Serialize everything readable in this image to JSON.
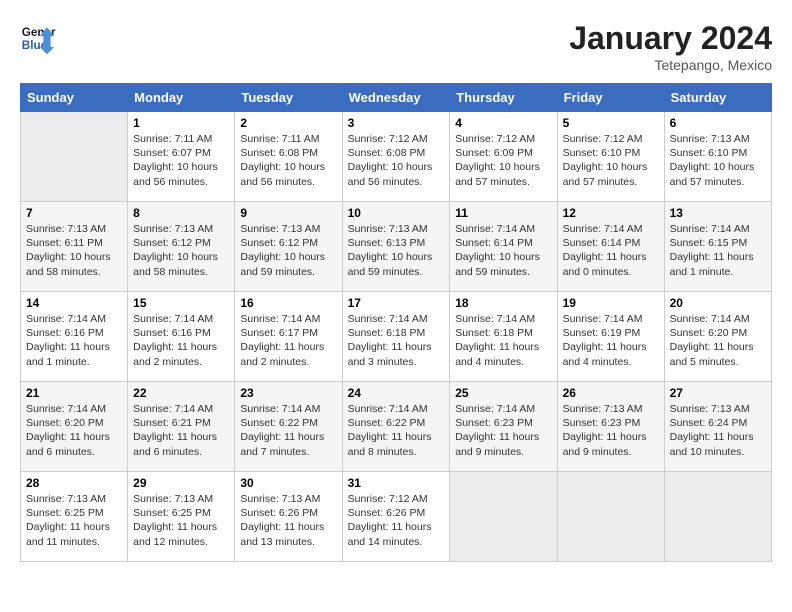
{
  "header": {
    "logo": {
      "line1": "General",
      "line2": "Blue"
    },
    "title": "January 2024",
    "subtitle": "Tetepango, Mexico"
  },
  "days_of_week": [
    "Sunday",
    "Monday",
    "Tuesday",
    "Wednesday",
    "Thursday",
    "Friday",
    "Saturday"
  ],
  "weeks": [
    [
      {
        "day": "",
        "info": ""
      },
      {
        "day": "1",
        "info": "Sunrise: 7:11 AM\nSunset: 6:07 PM\nDaylight: 10 hours\nand 56 minutes."
      },
      {
        "day": "2",
        "info": "Sunrise: 7:11 AM\nSunset: 6:08 PM\nDaylight: 10 hours\nand 56 minutes."
      },
      {
        "day": "3",
        "info": "Sunrise: 7:12 AM\nSunset: 6:08 PM\nDaylight: 10 hours\nand 56 minutes."
      },
      {
        "day": "4",
        "info": "Sunrise: 7:12 AM\nSunset: 6:09 PM\nDaylight: 10 hours\nand 57 minutes."
      },
      {
        "day": "5",
        "info": "Sunrise: 7:12 AM\nSunset: 6:10 PM\nDaylight: 10 hours\nand 57 minutes."
      },
      {
        "day": "6",
        "info": "Sunrise: 7:13 AM\nSunset: 6:10 PM\nDaylight: 10 hours\nand 57 minutes."
      }
    ],
    [
      {
        "day": "7",
        "info": "Sunrise: 7:13 AM\nSunset: 6:11 PM\nDaylight: 10 hours\nand 58 minutes."
      },
      {
        "day": "8",
        "info": "Sunrise: 7:13 AM\nSunset: 6:12 PM\nDaylight: 10 hours\nand 58 minutes."
      },
      {
        "day": "9",
        "info": "Sunrise: 7:13 AM\nSunset: 6:12 PM\nDaylight: 10 hours\nand 59 minutes."
      },
      {
        "day": "10",
        "info": "Sunrise: 7:13 AM\nSunset: 6:13 PM\nDaylight: 10 hours\nand 59 minutes."
      },
      {
        "day": "11",
        "info": "Sunrise: 7:14 AM\nSunset: 6:14 PM\nDaylight: 10 hours\nand 59 minutes."
      },
      {
        "day": "12",
        "info": "Sunrise: 7:14 AM\nSunset: 6:14 PM\nDaylight: 11 hours\nand 0 minutes."
      },
      {
        "day": "13",
        "info": "Sunrise: 7:14 AM\nSunset: 6:15 PM\nDaylight: 11 hours\nand 1 minute."
      }
    ],
    [
      {
        "day": "14",
        "info": "Sunrise: 7:14 AM\nSunset: 6:16 PM\nDaylight: 11 hours\nand 1 minute."
      },
      {
        "day": "15",
        "info": "Sunrise: 7:14 AM\nSunset: 6:16 PM\nDaylight: 11 hours\nand 2 minutes."
      },
      {
        "day": "16",
        "info": "Sunrise: 7:14 AM\nSunset: 6:17 PM\nDaylight: 11 hours\nand 2 minutes."
      },
      {
        "day": "17",
        "info": "Sunrise: 7:14 AM\nSunset: 6:18 PM\nDaylight: 11 hours\nand 3 minutes."
      },
      {
        "day": "18",
        "info": "Sunrise: 7:14 AM\nSunset: 6:18 PM\nDaylight: 11 hours\nand 4 minutes."
      },
      {
        "day": "19",
        "info": "Sunrise: 7:14 AM\nSunset: 6:19 PM\nDaylight: 11 hours\nand 4 minutes."
      },
      {
        "day": "20",
        "info": "Sunrise: 7:14 AM\nSunset: 6:20 PM\nDaylight: 11 hours\nand 5 minutes."
      }
    ],
    [
      {
        "day": "21",
        "info": "Sunrise: 7:14 AM\nSunset: 6:20 PM\nDaylight: 11 hours\nand 6 minutes."
      },
      {
        "day": "22",
        "info": "Sunrise: 7:14 AM\nSunset: 6:21 PM\nDaylight: 11 hours\nand 6 minutes."
      },
      {
        "day": "23",
        "info": "Sunrise: 7:14 AM\nSunset: 6:22 PM\nDaylight: 11 hours\nand 7 minutes."
      },
      {
        "day": "24",
        "info": "Sunrise: 7:14 AM\nSunset: 6:22 PM\nDaylight: 11 hours\nand 8 minutes."
      },
      {
        "day": "25",
        "info": "Sunrise: 7:14 AM\nSunset: 6:23 PM\nDaylight: 11 hours\nand 9 minutes."
      },
      {
        "day": "26",
        "info": "Sunrise: 7:13 AM\nSunset: 6:23 PM\nDaylight: 11 hours\nand 9 minutes."
      },
      {
        "day": "27",
        "info": "Sunrise: 7:13 AM\nSunset: 6:24 PM\nDaylight: 11 hours\nand 10 minutes."
      }
    ],
    [
      {
        "day": "28",
        "info": "Sunrise: 7:13 AM\nSunset: 6:25 PM\nDaylight: 11 hours\nand 11 minutes."
      },
      {
        "day": "29",
        "info": "Sunrise: 7:13 AM\nSunset: 6:25 PM\nDaylight: 11 hours\nand 12 minutes."
      },
      {
        "day": "30",
        "info": "Sunrise: 7:13 AM\nSunset: 6:26 PM\nDaylight: 11 hours\nand 13 minutes."
      },
      {
        "day": "31",
        "info": "Sunrise: 7:12 AM\nSunset: 6:26 PM\nDaylight: 11 hours\nand 14 minutes."
      },
      {
        "day": "",
        "info": ""
      },
      {
        "day": "",
        "info": ""
      },
      {
        "day": "",
        "info": ""
      }
    ]
  ]
}
